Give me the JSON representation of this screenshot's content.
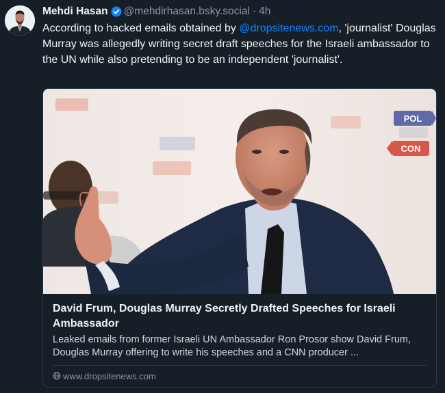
{
  "post": {
    "author": {
      "display_name": "Mehdi Hasan",
      "handle": "@mehdirhasan.bsky.social",
      "verified": true
    },
    "separator": "·",
    "timestamp": "4h",
    "text_before_mention": "According to hacked emails obtained by ",
    "mention": "@dropsitenews.com",
    "text_after_mention": ", 'journalist' Douglas Murray was allegedly writing secret draft speeches for the Israeli ambassador to the UN while also pretending to be an independent 'journalist'."
  },
  "link_card": {
    "title": "David Frum, Douglas Murray Secretly Drafted Speeches for Israeli Ambassador",
    "description": "Leaked emails from former Israeli UN Ambassador Ron Prosor show David Frum, Douglas Murray offering to write his speeches and a CNN producer ...",
    "domain": "www.dropsitenews.com",
    "domain_icon": "globe-icon",
    "thumbnail": {
      "banner_text_1": "POL",
      "banner_text_2": "CON"
    }
  },
  "colors": {
    "background": "#161e27",
    "text_primary": "#f1f3f5",
    "text_secondary": "#8b98a5",
    "link": "#1083fe",
    "verified_badge": "#1083fe",
    "card_border": "#2e3a47"
  }
}
